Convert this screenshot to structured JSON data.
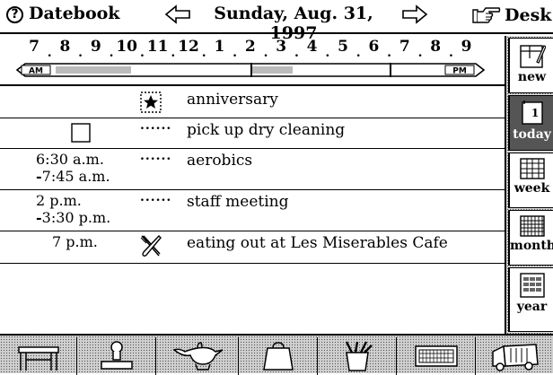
{
  "titlebar": {
    "app_icon": "question-circle-icon",
    "app_name": "Datebook",
    "date": "Sunday, Aug. 31, 1997",
    "desk_label": "Desk"
  },
  "timeline": {
    "hours": [
      "7",
      "8",
      "9",
      "10",
      "11",
      "12",
      "1",
      "2",
      "3",
      "4",
      "5",
      "6",
      "7",
      "8",
      "9"
    ],
    "am_label": "AM",
    "pm_label": "PM"
  },
  "events": [
    {
      "time_start": "",
      "time_end": "",
      "marker": "star-icon",
      "text": "anniversary"
    },
    {
      "time_start": "",
      "time_end": "",
      "marker": "checkbox-icon",
      "text": "pick up dry cleaning"
    },
    {
      "time_start": "6:30 a.m.",
      "time_end": "7:45 a.m.",
      "marker": "dots",
      "dots": "......",
      "text": "aerobics"
    },
    {
      "time_start": "2 p.m.",
      "time_end": "3:30 p.m.",
      "marker": "dots",
      "dots": "......",
      "text": "staff meeting"
    },
    {
      "time_start": "7 p.m.",
      "time_end": "",
      "marker": "fork-knife-icon",
      "text": "eating out at Les Miserables Cafe"
    }
  ],
  "sidebar": {
    "tabs": [
      {
        "label": "new",
        "icon": "new-page-icon",
        "active": false
      },
      {
        "label": "today",
        "icon": "today-calendar-icon",
        "day": "1",
        "active": true
      },
      {
        "label": "week",
        "icon": "week-grid-icon",
        "active": false
      },
      {
        "label": "month",
        "icon": "month-grid-icon",
        "active": false
      },
      {
        "label": "year",
        "icon": "year-grid-icon",
        "active": false
      }
    ]
  },
  "toolbar": {
    "tools": [
      "desk-icon",
      "stamp-icon",
      "genie-lamp-icon",
      "bag-icon",
      "pencil-cup-icon",
      "keyboard-icon",
      "truck-icon"
    ]
  }
}
